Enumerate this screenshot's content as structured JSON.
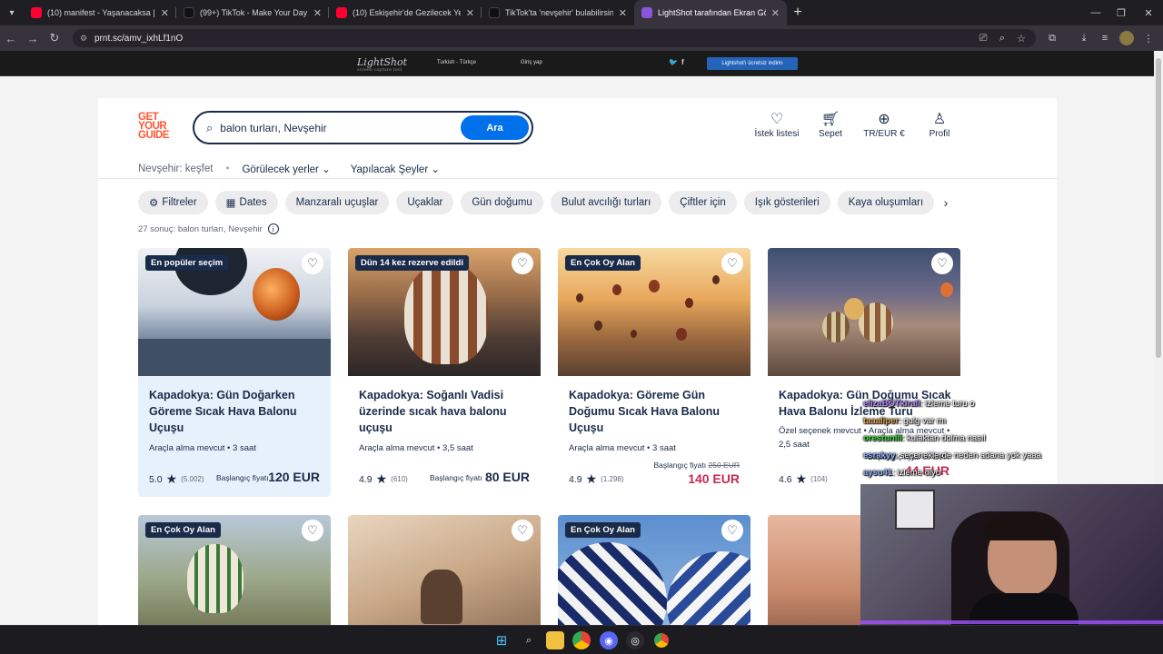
{
  "browser": {
    "tabs": [
      {
        "title": "(10) manifest - Yaşanacaksa | O",
        "icon": "youtube-icon",
        "color": "#ff0033"
      },
      {
        "title": "(99+) TikTok - Make Your Day",
        "icon": "tiktok-icon",
        "color": "#111111"
      },
      {
        "title": "(10) Eskişehir'de Gezilecek Yerle",
        "icon": "youtube-icon",
        "color": "#ff0033"
      },
      {
        "title": "TikTok'ta 'nevşehir' bulabilirsin",
        "icon": "tiktok-icon",
        "color": "#111111"
      },
      {
        "title": "LightShot tarafından Ekran Gör",
        "icon": "lightshot-icon",
        "color": "#8a55d8"
      }
    ],
    "url": "prnt.sc/amv_ixhLf1nO"
  },
  "lightshot": {
    "logo": "LightShot",
    "tagline": "screen capture tool",
    "language": "Turkish - Türkçe",
    "login": "Giriş yap",
    "download": "Lightshot'ı ücretsiz indirin"
  },
  "site": {
    "logo_lines": [
      "GET",
      "YOUR",
      "GUIDE"
    ],
    "search_value": "balon turları, Nevşehir",
    "search_button": "Ara",
    "header_icons": [
      {
        "label": "İstek listesi",
        "icon": "heart-icon"
      },
      {
        "label": "Sepet",
        "icon": "cart-icon"
      },
      {
        "label": "TR/EUR €",
        "icon": "globe-icon"
      },
      {
        "label": "Profil",
        "icon": "profile-icon"
      }
    ],
    "subnav": {
      "location": "Nevşehir: keşfet",
      "places": "Görülecek yerler",
      "things": "Yapılacak Şeyler"
    },
    "chips": [
      "Filtreler",
      "Dates",
      "Manzaralı uçuşlar",
      "Uçaklar",
      "Gün doğumu",
      "Bulut avcılığı turları",
      "Çiftler için",
      "Işık gösterileri",
      "Kaya oluşumları"
    ],
    "result_count": "27 sonuç: balon turları, Nevşehir",
    "products": [
      {
        "badge": "En popüler seçim",
        "title": "Kapadokya: Gün Doğarken Göreme Sıcak Hava Balonu Uçuşu",
        "meta": "Araçla alma mevcut • 3 saat",
        "rating": "5.0",
        "reviews": "(5.002)",
        "from": "Başlangıç fiyatı",
        "price": "120 EUR"
      },
      {
        "badge": "Dün 14 kez rezerve edildi",
        "title": "Kapadokya: Soğanlı Vadisi üzerinde sıcak hava balonu uçuşu",
        "meta": "Araçla alma mevcut • 3,5 saat",
        "rating": "4.9",
        "reviews": "(610)",
        "from": "Başlangıç fiyatı",
        "price": "80 EUR"
      },
      {
        "badge": "En Çok Oy Alan",
        "title": "Kapadokya: Göreme Gün Doğumu Sıcak Hava Balonu Uçuşu",
        "meta": "Araçla alma mevcut • 3 saat",
        "rating": "4.9",
        "reviews": "(1.298)",
        "from": "Başlangıç fiyatı",
        "old_price": "250 EUR",
        "price": "140 EUR"
      },
      {
        "badge": "",
        "title": "Kapadokya: Gün Doğumu Sıcak Hava Balonu İzleme Turu",
        "meta": "Özel seçenek mevcut • Araçla alma mevcut • 2,5 saat",
        "rating": "4.6",
        "reviews": "(104)",
        "from": "Başlangıç fiyatı",
        "old_price": "50 EUR",
        "price": "44 EUR"
      }
    ],
    "row2_badges": [
      "En Çok Oy Alan",
      "",
      "En Çok Oy Alan",
      ""
    ]
  },
  "chat": [
    {
      "user": "elizaBOTkirali",
      "color": "#b58cff",
      "text": ": izleme turu o"
    },
    {
      "user": "taaaliper",
      "color": "#e0a050",
      "text": ": gulg var mı"
    },
    {
      "user": "orestuniii",
      "color": "#44dd44",
      "text": ": kulaktan dolma nasıl"
    },
    {
      "user": "esrakyy",
      "color": "#8fb6ff",
      "text": ": seçeneklerde neden adana yok yaaa"
    },
    {
      "user": "aysu41",
      "color": "#8fb6ff",
      "text": ": izleme diyo"
    }
  ]
}
